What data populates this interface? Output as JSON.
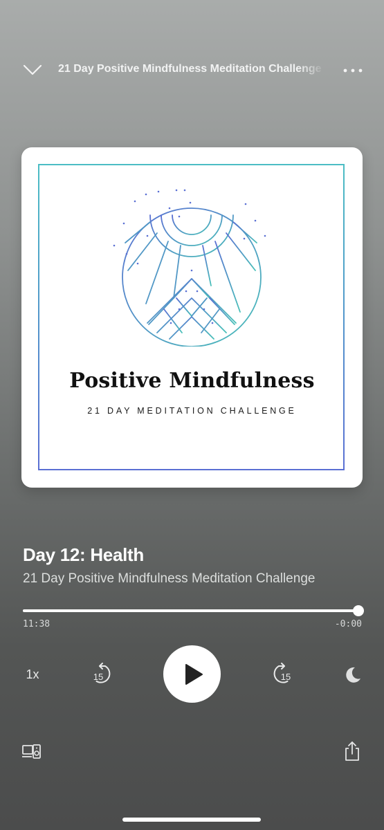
{
  "header": {
    "context_title": "21 Day Positive Mindfulness Meditation Challenge",
    "collapse_icon": "chevron-down-icon",
    "more_icon": "more-horizontal-icon"
  },
  "artwork": {
    "title": "Positive Mindfulness",
    "subtitle": "21 DAY MEDITATION CHALLENGE",
    "frame_color_top": "#4bbdc4",
    "frame_color_bottom": "#5a6fd3"
  },
  "episode": {
    "title": "Day 12: Health",
    "show": "21 Day Positive Mindfulness Meditation Challenge"
  },
  "playback": {
    "elapsed": "11:38",
    "remaining": "-0:00",
    "progress": 1.0,
    "speed": "1x",
    "rewind_seconds": "15",
    "forward_seconds": "15"
  },
  "icons": {
    "play": "play-icon",
    "rewind": "rewind-15-icon",
    "forward": "forward-15-icon",
    "sleep": "moon-icon",
    "devices": "connect-devices-icon",
    "share": "share-icon"
  },
  "colors": {
    "background_top": "#a9acab",
    "background_bottom": "#4b4c4c",
    "accent": "#ffffff"
  }
}
